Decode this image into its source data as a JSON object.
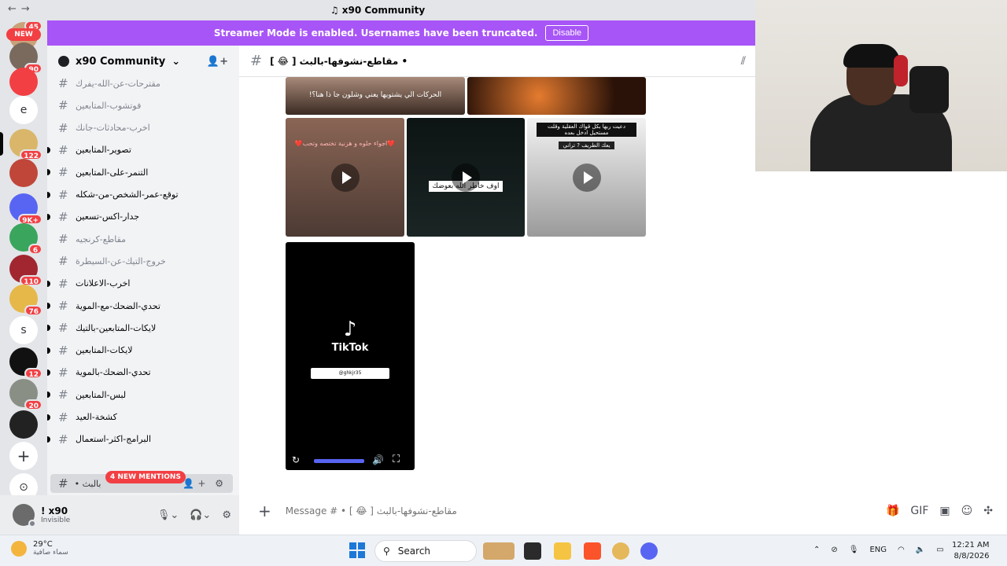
{
  "window": {
    "title": "x90 Community",
    "nav_back": "←",
    "nav_forward": "→"
  },
  "banner": {
    "text": "Streamer Mode is enabled. Usernames have been truncated.",
    "button": "Disable"
  },
  "rail": {
    "new_label": "NEW",
    "badges": [
      "45",
      "90",
      "122",
      "9K+",
      "6",
      "110",
      "76",
      "12",
      "20"
    ],
    "letter_e": "e",
    "letter_s": "s",
    "add_server": "+",
    "discover": "⊙"
  },
  "server": {
    "name": "x90 Community",
    "chevron": "⌄"
  },
  "channels": [
    {
      "name": "مقترحات-عن-الله-يفرك",
      "muted": true
    },
    {
      "name": "فوتشوب-المتابعين",
      "muted": true
    },
    {
      "name": "اخرب-محادثات-جانك",
      "muted": true
    },
    {
      "name": "تصوير-المتابعين",
      "muted": false
    },
    {
      "name": "التنمر-على-المتابعين",
      "muted": false
    },
    {
      "name": "توقع-عمر-الشخص-من-شكله",
      "muted": false
    },
    {
      "name": "جدار-اكس-تسعين",
      "muted": false
    },
    {
      "name": "مقاطع-كرنجيه",
      "muted": true
    },
    {
      "name": "خروج-التيك-عن-السيطرة",
      "muted": true
    },
    {
      "name": "اخرب-الاعلانات",
      "muted": false
    },
    {
      "name": "تحدي-الضحك-مع-الموية",
      "muted": false
    },
    {
      "name": "لايكات-المتابعين-بالتيك",
      "muted": false
    },
    {
      "name": "لايكات-المتابعين",
      "muted": false
    },
    {
      "name": "تحدي-الضحك-بالموية",
      "muted": false
    },
    {
      "name": "لبس-المتابعين",
      "muted": false
    },
    {
      "name": "كشخة-العيد",
      "muted": false
    },
    {
      "name": "البرامج-اكثر-استعمال",
      "muted": false
    }
  ],
  "mentions": "4 NEW MENTIONS",
  "active_channel": {
    "name": "• بالبث",
    "icons": "👤+ ⚙"
  },
  "user": {
    "name": "! x90",
    "status": "Invisible"
  },
  "chat": {
    "channel": "[ 😂 ] مقاطع-نشوفها-بالبث •",
    "captions": {
      "top": "الحركات الي يشتويها يعني وشلون جا ذا هنا؟!",
      "v1": "❤️اجواء حلوه و هزنية تختصه وتحب❤️",
      "v2": "اوف خاطر الله بعوضك",
      "v3": "دعيت ربها بكل قواك العقلية وقلت مستحيل ادخل بعده",
      "v3b": "يعك الطريف ? تراني"
    },
    "tiktok": {
      "name": "TikTok",
      "handle": "@ghkjr35"
    },
    "placeholder": "Message # • [ 😂 ] مقاطع-نشوفها-بالبث"
  },
  "taskbar": {
    "temp": "29°C",
    "weather": "سماء صافية",
    "search": "Search",
    "lang": "ENG",
    "time": "12:21 AM",
    "date": "8/8/2026"
  },
  "colors": {
    "accent": "#a855f7",
    "badge": "#f23f43",
    "blurple": "#5865f2"
  }
}
